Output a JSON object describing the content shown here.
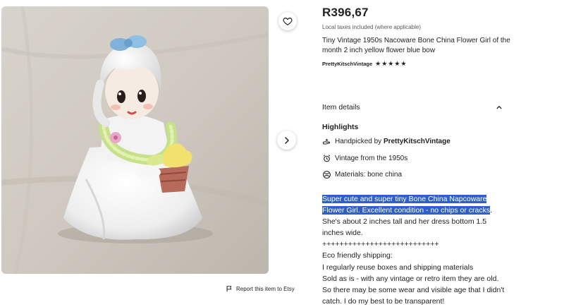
{
  "listing": {
    "price": "R396,67",
    "tax_note": "Local taxes included (where applicable)",
    "title": "Tiny Vintage 1950s Nacoware Bone China Flower Girl of the month 2 inch yellow flower blue bow",
    "shop_name": "PrettyKitschVintage",
    "rating_stars": "★★★★★"
  },
  "gallery": {
    "image_alt": "Vintage bone china flower girl figurine"
  },
  "report_link": "Report this item to Etsy",
  "item_details": {
    "heading": "Item details",
    "highlights_heading": "Highlights",
    "handpicked_prefix": "Handpicked by ",
    "handpicked_shop": "PrettyKitschVintage",
    "vintage": "Vintage from the 1950s",
    "materials": "Materials: bone china"
  },
  "description": {
    "selected_line_1": "Super cute and super tiny Bone China Napcoware",
    "selected_line_2": "Flower Girl. Excellent condition - no chips or cracks",
    "line_2_tail": ".",
    "line_3": "She's about 2 inches tall and her dress bottom 1.5",
    "line_4": "inches wide.",
    "line_5": "+++++++++++++++++++++++++++",
    "line_6": "Eco friendly shipping:",
    "line_7": "I regularly reuse boxes and shipping materials",
    "line_8": "Sold as is - with any vintage or retro item they are old.",
    "line_9": "So there may be some wear and visible age that I didn't",
    "line_10": "catch. I do my best to be transparent!"
  }
}
